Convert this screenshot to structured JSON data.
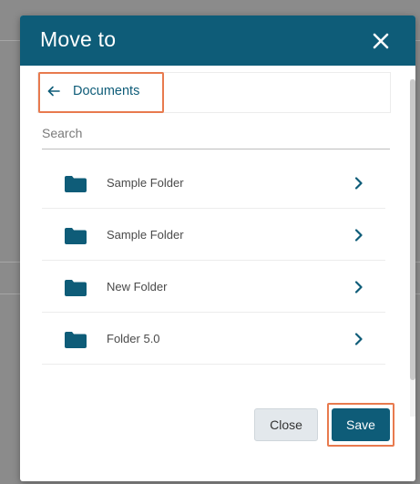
{
  "dialog": {
    "title": "Move to",
    "close_icon": "close-icon"
  },
  "breadcrumb": {
    "back_icon": "arrow-left-icon",
    "label": "Documents"
  },
  "search": {
    "placeholder": "Search",
    "value": ""
  },
  "folders": [
    {
      "name": "Sample Folder",
      "icon": "folder-icon"
    },
    {
      "name": "Sample Folder",
      "icon": "folder-icon"
    },
    {
      "name": "New Folder",
      "icon": "folder-icon"
    },
    {
      "name": "Folder 5.0",
      "icon": "folder-icon"
    }
  ],
  "footer": {
    "close_label": "Close",
    "save_label": "Save"
  },
  "colors": {
    "header": "#0e5c78",
    "accent": "#0e5c78",
    "highlight": "#e87a4e",
    "folder": "#0e5c78"
  }
}
